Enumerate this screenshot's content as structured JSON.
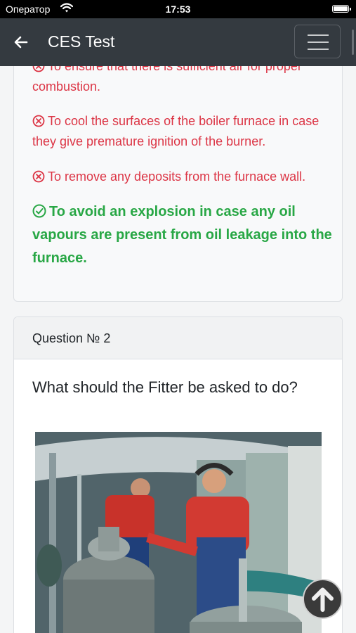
{
  "status_bar": {
    "carrier": "Оператор",
    "time": "17:53"
  },
  "navbar": {
    "title": "CES Test"
  },
  "question1": {
    "answers": [
      {
        "text": "To ensure that there is sufficient air for proper combustion.",
        "state": "wrong"
      },
      {
        "text": "To cool the surfaces of the boiler furnace in case they give premature ignition of the burner.",
        "state": "wrong"
      },
      {
        "text": "To remove any deposits from the furnace wall.",
        "state": "wrong"
      },
      {
        "text": "To avoid an explosion in case any oil vapours are present from oil leakage into the furnace.",
        "state": "correct"
      }
    ]
  },
  "question2": {
    "header": "Question № 2",
    "text": "What should the Fitter be asked to do?"
  },
  "colors": {
    "navbar": "#343a40",
    "wrong": "#dc3545",
    "correct": "#28a745"
  },
  "icons": {
    "back": "arrow-left-icon",
    "menu": "hamburger-icon",
    "wrong": "x-circle-icon",
    "correct": "check-circle-icon",
    "scroll_top": "arrow-up-circle-icon"
  }
}
